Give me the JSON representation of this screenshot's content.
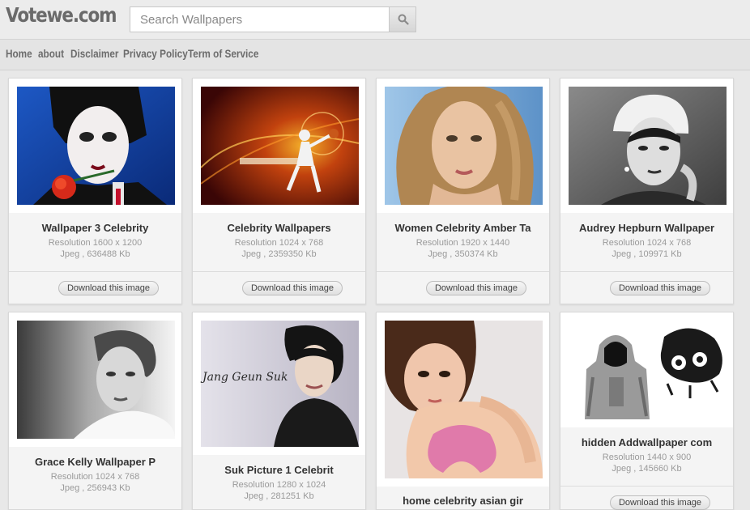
{
  "site": {
    "logo": "Votewe.com"
  },
  "search": {
    "placeholder": "Search Wallpapers",
    "value": "",
    "icon": "search-icon"
  },
  "nav": {
    "items": [
      {
        "label": "Home"
      },
      {
        "label": "about"
      },
      {
        "label": "Disclaimer"
      },
      {
        "label": "Privacy Policy"
      },
      {
        "label": "Term of Service"
      }
    ]
  },
  "wallpapers": [
    {
      "title": "Wallpaper 3 Celebrity",
      "resolution": "Resolution 1600 x 1200",
      "file": "Jpeg , 636488 Kb",
      "download_label": "Download this image"
    },
    {
      "title": "Celebrity Wallpapers",
      "resolution": "Resolution 1024 x 768",
      "file": "Jpeg , 2359350 Kb",
      "download_label": "Download this image"
    },
    {
      "title": "Women Celebrity Amber Ta",
      "resolution": "Resolution 1920 x 1440",
      "file": "Jpeg , 350374 Kb",
      "download_label": "Download this image"
    },
    {
      "title": "Audrey Hepburn Wallpaper",
      "resolution": "Resolution 1024 x 768",
      "file": "Jpeg , 109971 Kb",
      "download_label": "Download this image"
    },
    {
      "title": "Grace Kelly Wallpaper P",
      "resolution": "Resolution 1024 x 768",
      "file": "Jpeg , 256943 Kb",
      "download_label": "Download this image"
    },
    {
      "title": "Suk Picture 1 Celebrit",
      "resolution": "Resolution 1280 x 1024",
      "file": "Jpeg , 281251 Kb",
      "download_label": "Download this image",
      "image_caption": "Jang Geun Suk"
    },
    {
      "title": "home celebrity asian gir",
      "resolution": "",
      "file": "",
      "download_label": ""
    },
    {
      "title": "hidden Addwallpaper com",
      "resolution": "Resolution 1440 x 900",
      "file": "Jpeg , 145660 Kb",
      "download_label": "Download this image"
    }
  ],
  "colors": {
    "page_background": "#e8e8e8",
    "logo": "#6a6a6a",
    "nav_text": "#6c6c6c",
    "card_background": "#f4f4f4",
    "meta_text": "#9a9a9a"
  }
}
